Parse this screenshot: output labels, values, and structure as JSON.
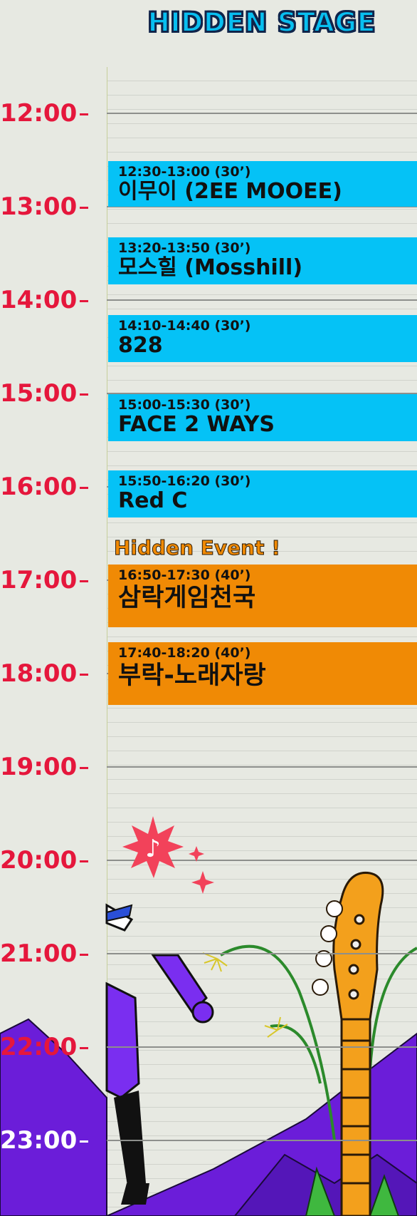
{
  "stage": {
    "title": "HIDDEN STAGE"
  },
  "hours": [
    "12:00",
    "13:00",
    "14:00",
    "15:00",
    "16:00",
    "17:00",
    "18:00",
    "19:00",
    "20:00",
    "21:00",
    "22:00",
    "23:00"
  ],
  "event": {
    "label": "Hidden Event !"
  },
  "slots": [
    {
      "time": "12:30-13:00 (30’)",
      "name": "이무이 (2EE MOOEE)",
      "kind": "performance"
    },
    {
      "time": "13:20-13:50 (30’)",
      "name": "모스힐 (Mosshill)",
      "kind": "performance"
    },
    {
      "time": "14:10-14:40 (30’)",
      "name": "828",
      "kind": "performance"
    },
    {
      "time": "15:00-15:30 (30’)",
      "name": "FACE 2 WAYS",
      "kind": "performance"
    },
    {
      "time": "15:50-16:20 (30’)",
      "name": "Red C",
      "kind": "performance"
    },
    {
      "time": "16:50-17:30 (40’)",
      "name": "삼락게임천국",
      "kind": "event"
    },
    {
      "time": "17:40-18:20 (40’)",
      "name": "부락-노래자랑",
      "kind": "event"
    }
  ],
  "colors": {
    "performance": "#05c2f6",
    "event": "#f08a05",
    "hour_label": "#e5173c",
    "background": "#e7e9e2"
  },
  "icons": [
    "music-note-burst-icon",
    "sparkle-icon",
    "guitar-illustration",
    "runner-illustration",
    "mountains-illustration",
    "plant-illustration"
  ]
}
